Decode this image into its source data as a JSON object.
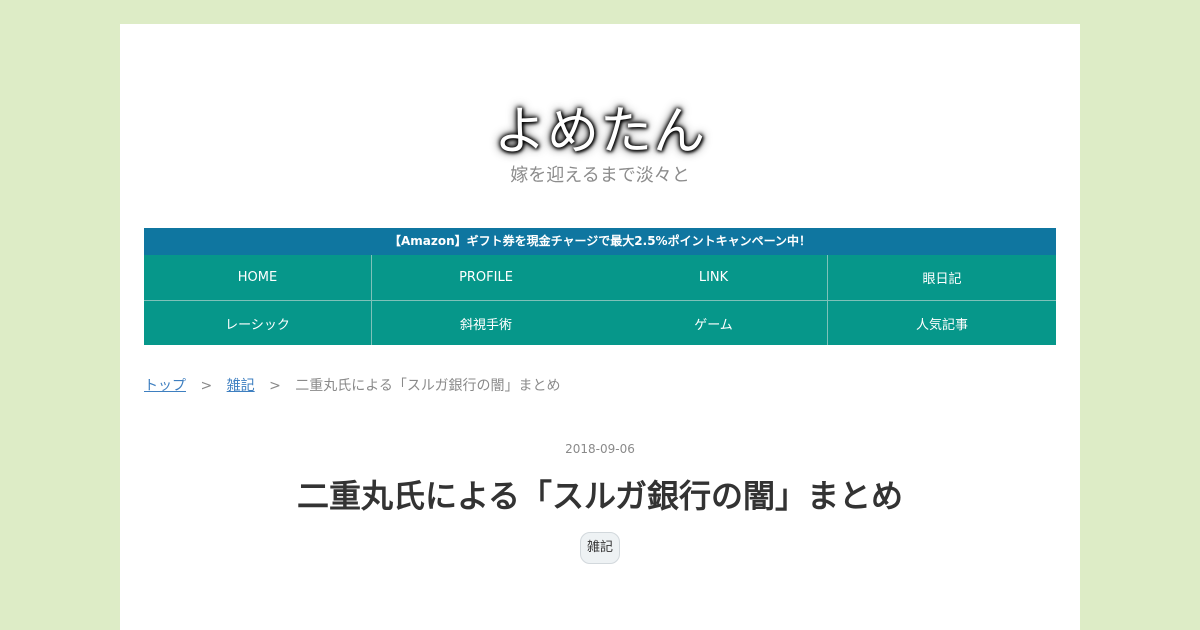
{
  "site": {
    "title": "よめたん",
    "description": "嫁を迎えるまで淡々と"
  },
  "notice": {
    "text": "【Amazon】ギフト券を現金チャージで最大2.5%ポイントキャンペーン中！"
  },
  "nav": {
    "row1": [
      "HOME",
      "PROFILE",
      "LINK",
      "眼日記"
    ],
    "row2": [
      "レーシック",
      "斜視手術",
      "ゲーム",
      "人気記事"
    ]
  },
  "breadcrumb": {
    "top": "トップ",
    "category": "雑記",
    "separator": ">",
    "current": "二重丸氏による「スルガ銀行の闇」まとめ"
  },
  "post": {
    "date": "2018-09-06",
    "title": "二重丸氏による「スルガ銀行の闇」まとめ",
    "category": "雑記"
  },
  "colors": {
    "background": "#ddecc6",
    "notice_bar": "#0f76a0",
    "nav_bar": "#06978a",
    "link": "#3e7fc0"
  }
}
